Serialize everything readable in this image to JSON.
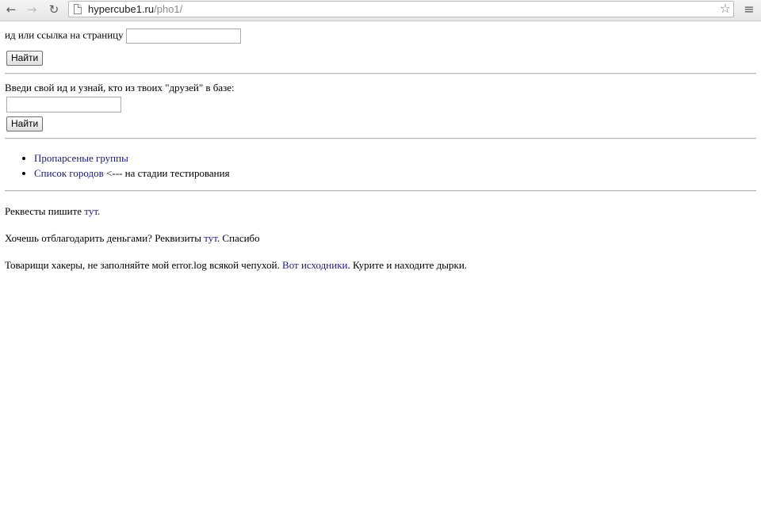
{
  "browser": {
    "back_icon": "←",
    "forward_icon": "→",
    "reload_icon": "↻",
    "url_host": "hypercube1.ru",
    "url_path": "/pho1/",
    "star_icon": "☆",
    "menu_icon": "≡"
  },
  "search1": {
    "label": "ид или ссылка на страницу",
    "value": "",
    "button": "Найти"
  },
  "search2": {
    "label": "Введи свой ид и узнай, кто из твоих \"друзей\" в базе:",
    "value": "",
    "button": "Найти"
  },
  "links": {
    "item1": "Пропарсеные группы",
    "item2": "Список городов",
    "item2_suffix": " <--- на стадии тестирования"
  },
  "footer": {
    "requests_text": "Реквесты пишите ",
    "requests_link": "тут",
    "requests_end": ".",
    "donate_text": "Хочешь отблагодарить деньгами? Реквизиты ",
    "donate_link": "тут",
    "donate_end": ". Спасибо",
    "hackers_text": "Товарищи хакеры, не заполняйте мой error.log всякой чепухой. ",
    "hackers_link": "Вот исходники",
    "hackers_end": ". Курите и находите дырки."
  }
}
